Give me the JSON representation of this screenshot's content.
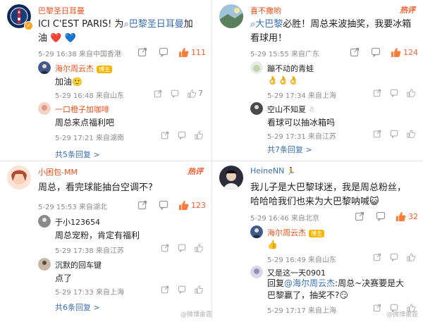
{
  "comments": [
    {
      "username": "巴黎圣日耳曼",
      "text_part1": "ICI C'EST PARIS! 为",
      "text_link": "巴黎圣日耳曼",
      "text_part2": "加油 ❤️ 💙",
      "meta": "5-29 16:38 来自中国香港",
      "likes": "111",
      "replies": [
        {
          "name": "海尔周云杰",
          "level": "博主",
          "text": "加油🙂",
          "meta": "5-29 16:48 来自山东",
          "likes": "7"
        },
        {
          "name": "一口橙子加咖啡",
          "text": "周总来点福利吧",
          "meta": "5-29 17:21 来自湖南"
        }
      ],
      "more": "共5条回复 >"
    },
    {
      "username": "喜不撒哟",
      "hot": "热评",
      "text_link": "大巴黎",
      "text_rest": "必胜！周总来波抽奖，我要冰箱看球用！",
      "meta": "5-29 15:55 来自广东",
      "likes": "124",
      "replies": [
        {
          "name": "蹦不动的青蛙",
          "text": "👌👌👌",
          "meta": "5-29 17:34 来自上海"
        },
        {
          "name": "空山不知夏",
          "text": "看球可以抽冰箱吗",
          "meta": "5-29 17:31 来自江苏"
        }
      ],
      "more": "共7条回复 >"
    },
    {
      "username": "小困包-MM",
      "hot": "热评",
      "text": "周总，看完球能抽台空调不?",
      "meta": "5-29 15:53 来自湖北",
      "likes": "123",
      "replies": [
        {
          "name": "于小123654",
          "text": "周总宠粉，肯定有福利",
          "meta": "5-29 17:38 来自江苏"
        },
        {
          "name": "沉默的回车键",
          "text": "点了",
          "meta": "5-29 17:33 来自上海"
        }
      ],
      "more": "共6条回复 >"
    },
    {
      "username": "HeineNN",
      "text": "我儿子是大巴黎球迷，我是周总粉丝，哈哈哈我们也来为大巴黎呐喊😺",
      "meta": "5-29 16:46 来自北京",
      "likes": "32",
      "replies": [
        {
          "name": "海尔周云杰",
          "level": "博主",
          "text": "👍",
          "meta": "5-29 16:49 来自山东"
        },
        {
          "name": "又是这一天0901",
          "text_prefix": "回复",
          "text_link": "@海尔周云杰",
          "text_rest": ":周总~决赛要是大巴黎赢了，抽奖不?😏",
          "meta": "5-29 17:17 来自上海"
        }
      ]
    }
  ],
  "watermark_left": "@微博雷霆",
  "watermark_right": "@微博雷霆"
}
